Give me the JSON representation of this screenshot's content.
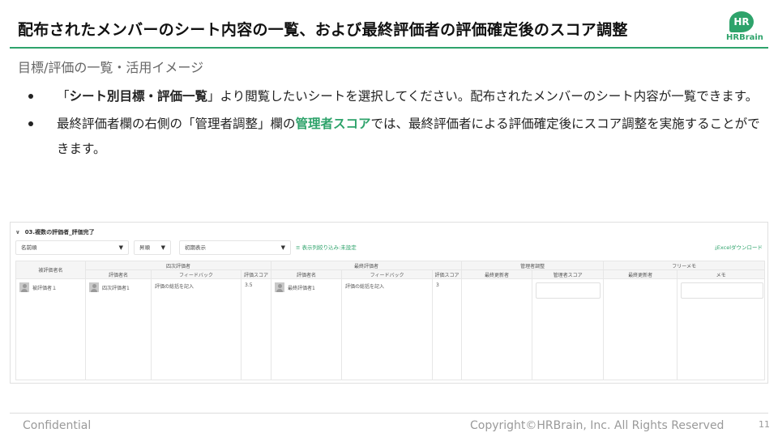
{
  "slide": {
    "title": "配布されたメンバーのシート内容の一覧、および最終評価者の評価確定後のスコア調整",
    "subtitle": "目標/評価の一覧・活用イメージ",
    "logo": {
      "mark": "HR",
      "text": "HRBrain",
      "color": "#2ea36b"
    },
    "bullets": [
      {
        "pre": "「",
        "bold": "シート別目標・評価一覧",
        "post": "」より閲覧したいシートを選択してください。配布されたメンバーのシート内容が一覧できます。"
      },
      {
        "pre": "最終評価者欄の右側の「管理者調整」欄の",
        "green": "管理者スコア",
        "post": "では、最終評価者による評価確定後にスコア調整を実施することができます。"
      }
    ],
    "footer": {
      "left": "Confidential",
      "right": "Copyright©HRBrain, Inc. All Rights Reserved",
      "page": "11"
    }
  },
  "screenshot": {
    "sheet_title": "03.複数の評価者_評価完了",
    "toolbar": {
      "sort": "名前順",
      "order": "昇順",
      "display": "初期表示",
      "filter_link": "表示列絞り込み:未設定",
      "excel_link": "Excelダウンロード"
    },
    "columns": {
      "evaluatee": "被評価者名",
      "group_4th": "四次評価者",
      "group_final": "最終評価者",
      "group_admin": "管理者調整",
      "group_memo": "フリーメモ",
      "evaluator_name": "評価者名",
      "feedback": "フィードバック",
      "score": "評価スコア",
      "updated_by": "最終更新者",
      "admin_score": "管理者スコア",
      "memo": "メモ"
    },
    "row": {
      "evaluatee": "被評価者１",
      "fourth_name": "四次評価者1",
      "fourth_feedback": "評価の総括を記入",
      "fourth_score": "3.5",
      "final_name": "最終評価者1",
      "final_feedback": "評価の総括を記入",
      "final_score": "3"
    }
  }
}
